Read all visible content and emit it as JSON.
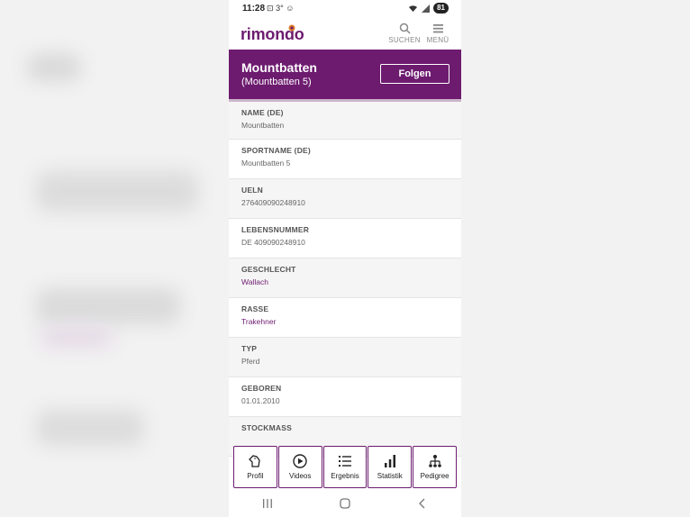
{
  "status_bar": {
    "time": "11:28",
    "indicators": "3°",
    "battery": "81"
  },
  "app": {
    "logo_text": "rimondo",
    "brand_color": "#6d1b6f"
  },
  "nav": {
    "search_label": "SUCHEN",
    "menu_label": "MENÜ"
  },
  "header": {
    "title": "Mountbatten",
    "subtitle": "(Mountbatten 5)",
    "follow_label": "Folgen"
  },
  "details": [
    {
      "label": "NAME (DE)",
      "value": "Mountbatten"
    },
    {
      "label": "SPORTNAME (DE)",
      "value": "Mountbatten 5"
    },
    {
      "label": "UELN",
      "value": "276409090248910"
    },
    {
      "label": "LEBENSNUMMER",
      "value": "DE 409090248910"
    },
    {
      "label": "GESCHLECHT",
      "value": "Wallach"
    },
    {
      "label": "RASSE",
      "value": "Trakehner"
    },
    {
      "label": "TYP",
      "value": "Pferd"
    },
    {
      "label": "GEBOREN",
      "value": "01.01.2010"
    },
    {
      "label": "STOCKMASS",
      "value": ""
    }
  ],
  "tabs": [
    {
      "label": "Profil",
      "icon": "horse-head-icon"
    },
    {
      "label": "Videos",
      "icon": "play-circle-icon"
    },
    {
      "label": "Ergebnis",
      "icon": "list-icon"
    },
    {
      "label": "Statistik",
      "icon": "bar-chart-icon"
    },
    {
      "label": "Pedigree",
      "icon": "pedigree-tree-icon"
    }
  ]
}
